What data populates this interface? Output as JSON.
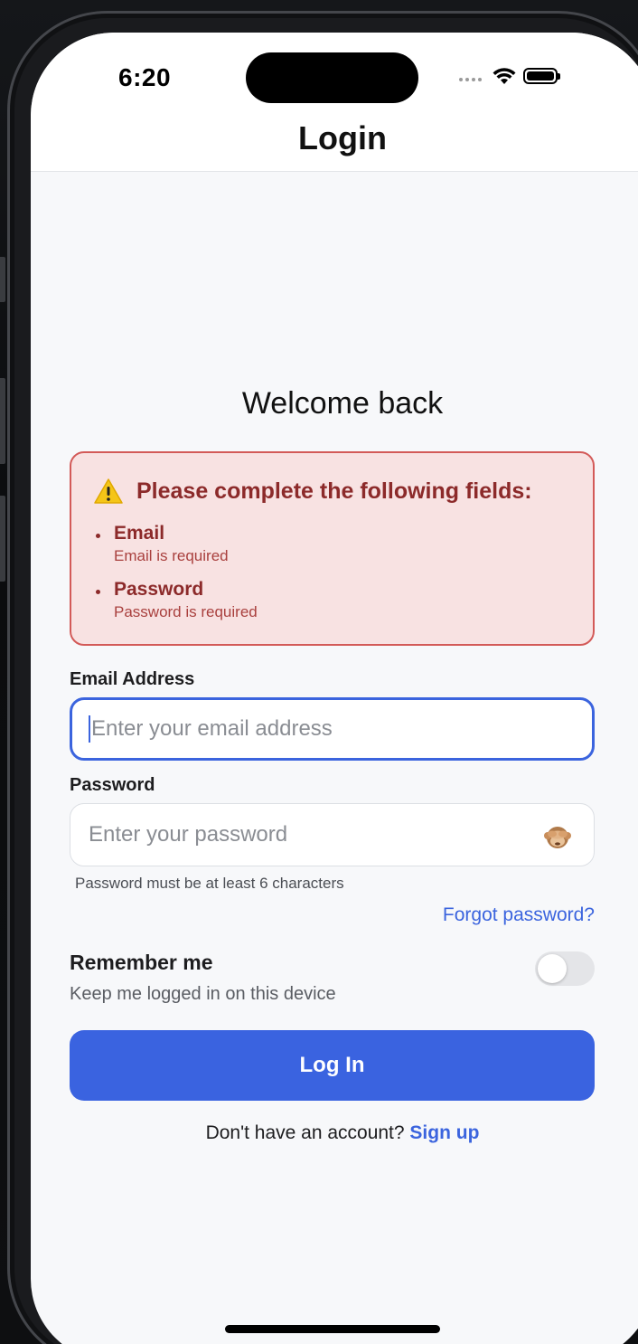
{
  "status_bar": {
    "time": "6:20"
  },
  "nav": {
    "title": "Login"
  },
  "welcome_text": "Welcome back",
  "error_box": {
    "title": "Please complete the following fields:",
    "items": [
      {
        "field": "Email",
        "message": "Email is required"
      },
      {
        "field": "Password",
        "message": "Password is required"
      }
    ]
  },
  "email": {
    "label": "Email Address",
    "placeholder": "Enter your email address",
    "value": ""
  },
  "password": {
    "label": "Password",
    "placeholder": "Enter your password",
    "value": "",
    "hint": "Password must be at least 6 characters",
    "toggle_icon": "see-no-evil-monkey-icon"
  },
  "forgot_password": "Forgot password?",
  "remember": {
    "title": "Remember me",
    "subtitle": "Keep me logged in on this device",
    "enabled": false
  },
  "login_button": "Log In",
  "signup": {
    "prompt": "Don't have an account?",
    "link": "Sign up"
  },
  "colors": {
    "accent": "#3a63e0",
    "error_bg": "#f8e2e2",
    "error_border": "#d35a58",
    "error_text": "#8c2a2a"
  }
}
